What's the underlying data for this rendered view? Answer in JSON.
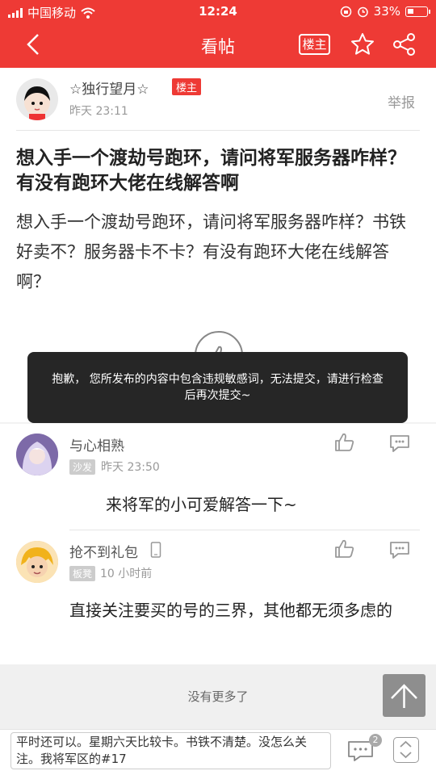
{
  "status_bar": {
    "carrier": "中国移动",
    "time": "12:24",
    "battery": "33%"
  },
  "header": {
    "title": "看帖",
    "owner_button": "楼主"
  },
  "post": {
    "author": "☆独行望月☆",
    "owner_tag": "楼主",
    "time": "昨天 23:11",
    "report": "举报",
    "title": "想入手一个渡劫号跑环，请问将军服务器咋样？有没有跑环大佬在线解答啊",
    "body": "想入手一个渡劫号跑环，请问将军服务器咋样？书铁好卖不？服务器卡不卡？有没有跑环大佬在线解答啊？"
  },
  "toast": {
    "message": "抱歉， 您所发布的内容中包含违规敏感词，无法提交，请进行检查后再次提交~"
  },
  "comments": [
    {
      "author": "与心相熟",
      "tag": "沙发",
      "time": "昨天 23:50",
      "text": "来将军的小可爱解答一下~"
    },
    {
      "author": "抢不到礼包",
      "tag": "板凳",
      "time": "10 小时前",
      "text": "直接关注要买的号的三界，其他都无须多虑的"
    }
  ],
  "footer": {
    "no_more": "没有更多了",
    "reply_text": "平时还可以。星期六天比较卡。书铁不清楚。没怎么关注。我将军区的#17",
    "comment_count": "2"
  }
}
